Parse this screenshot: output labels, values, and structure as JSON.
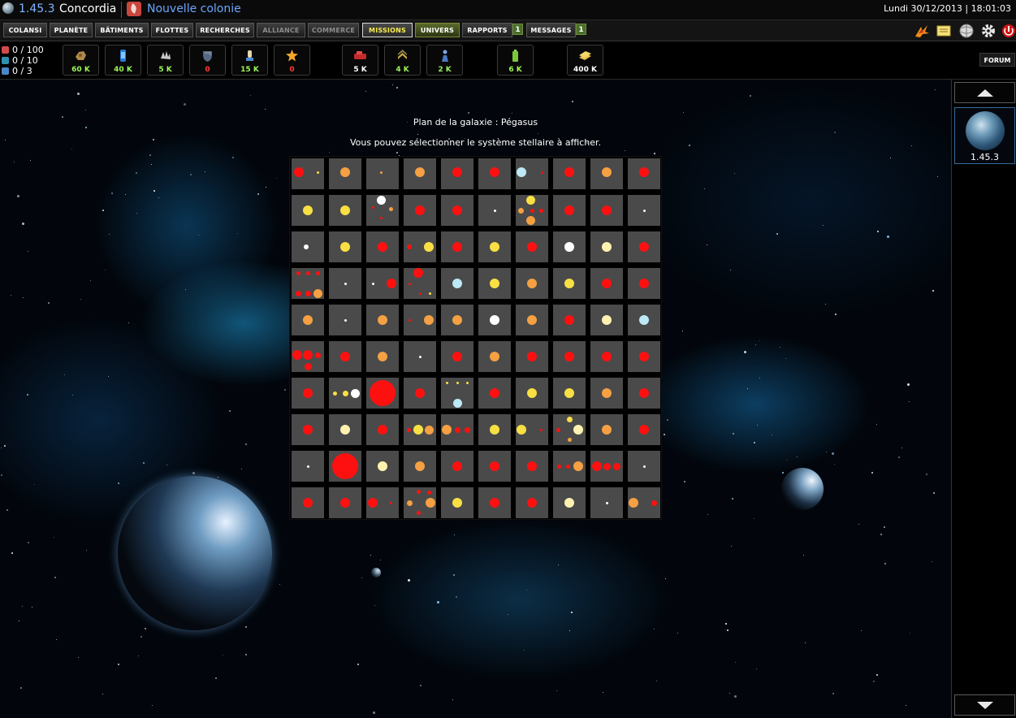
{
  "header": {
    "coords": "1.45.3",
    "planet_name": "Concordia",
    "new_colony": "Nouvelle colonie",
    "datetime": "Lundi 30/12/2013 | 18:01:03"
  },
  "nav": {
    "items": [
      {
        "label": "COLANSI"
      },
      {
        "label": "PLANÈTE"
      },
      {
        "label": "BÂTIMENTS"
      },
      {
        "label": "FLOTTES"
      },
      {
        "label": "RECHERCHES"
      },
      {
        "label": "ALLIANCE"
      },
      {
        "label": "COMMERCE"
      },
      {
        "label": "MISSIONS"
      },
      {
        "label": "UNIVERS"
      },
      {
        "label": "RAPPORTS",
        "badge": "1"
      },
      {
        "label": "MESSAGES",
        "badge": "1"
      }
    ],
    "top_icons": [
      "phoenix-icon",
      "notes-icon",
      "wiki-globe-icon",
      "gear-icon",
      "power-icon"
    ]
  },
  "stats": [
    {
      "text": "0 / 100",
      "icon": "population-icon"
    },
    {
      "text": "0 / 10",
      "icon": "fleet-slots-icon"
    },
    {
      "text": "0 / 3",
      "icon": "colony-slots-icon"
    }
  ],
  "resources": [
    {
      "icon": "ore-icon",
      "value": "60 K",
      "color": "#9bf55a"
    },
    {
      "icon": "fuel-cell-icon",
      "value": "40 K",
      "color": "#9bf55a"
    },
    {
      "icon": "crystal-icon",
      "value": "5 K",
      "color": "#9bf55a"
    },
    {
      "icon": "shield-resource-icon",
      "value": "0",
      "color": "#ff3b3b"
    },
    {
      "icon": "worker-icon",
      "value": "15 K",
      "color": "#9bf55a"
    },
    {
      "icon": "energy-star-icon",
      "value": "0",
      "color": "#ff3b3b"
    },
    {
      "icon": "tank-icon",
      "value": "5 K",
      "color": "#ffffff"
    },
    {
      "icon": "rank-insignia-icon",
      "value": "4 K",
      "color": "#9bf55a"
    },
    {
      "icon": "soldier-icon",
      "value": "2 K",
      "color": "#9bf55a"
    },
    {
      "icon": "battery-icon",
      "value": "6 K",
      "color": "#9bf55a"
    },
    {
      "icon": "credits-stack-icon",
      "value": "400 K",
      "color": "#ffffff"
    }
  ],
  "forum_label": "FORUM",
  "galaxy": {
    "title": "Plan de la galaxie : Pégasus",
    "subtitle": "Vous pouvez sélectionner le système stellaire à afficher.",
    "star_colors": {
      "r": "#ff1010",
      "o": "#f4a043",
      "y": "#f8df44",
      "w": "#ffffff",
      "pw": "#fff2b0",
      "b": "#bde8f6"
    },
    "cells": [
      [
        [
          "r",
          0.22,
          0.45,
          12
        ],
        [
          "y",
          0.82,
          0.45,
          3
        ]
      ],
      [
        [
          "o",
          0.5,
          0.45,
          12
        ]
      ],
      [
        [
          "o",
          0.45,
          0.45,
          3
        ]
      ],
      [
        [
          "o",
          0.5,
          0.45,
          12
        ]
      ],
      [
        [
          "r",
          0.5,
          0.45,
          12
        ]
      ],
      [
        [
          "r",
          0.5,
          0.45,
          12
        ]
      ],
      [
        [
          "b",
          0.18,
          0.45,
          12
        ],
        [
          "r",
          0.82,
          0.45,
          3
        ]
      ],
      [
        [
          "r",
          0.5,
          0.45,
          12
        ]
      ],
      [
        [
          "o",
          0.5,
          0.45,
          12
        ]
      ],
      [
        [
          "r",
          0.5,
          0.45,
          12
        ]
      ],
      [
        [
          "y",
          0.5,
          0.5,
          12
        ]
      ],
      [
        [
          "y",
          0.5,
          0.5,
          12
        ]
      ],
      [
        [
          "w",
          0.45,
          0.18,
          11
        ],
        [
          "o",
          0.75,
          0.45,
          5
        ],
        [
          "r",
          0.2,
          0.42,
          3
        ],
        [
          "r",
          0.45,
          0.75,
          3
        ]
      ],
      [
        [
          "r",
          0.5,
          0.5,
          12
        ]
      ],
      [
        [
          "r",
          0.5,
          0.5,
          12
        ]
      ],
      [
        [
          "w",
          0.5,
          0.5,
          3
        ]
      ],
      [
        [
          "y",
          0.45,
          0.18,
          11
        ],
        [
          "o",
          0.15,
          0.5,
          7
        ],
        [
          "r",
          0.5,
          0.5,
          5
        ],
        [
          "r",
          0.78,
          0.5,
          5
        ],
        [
          "o",
          0.45,
          0.82,
          11
        ]
      ],
      [
        [
          "r",
          0.5,
          0.5,
          12
        ]
      ],
      [
        [
          "r",
          0.5,
          0.5,
          12
        ]
      ],
      [
        [
          "w",
          0.5,
          0.5,
          3
        ]
      ],
      [
        [
          "w",
          0.45,
          0.5,
          6
        ]
      ],
      [
        [
          "y",
          0.5,
          0.5,
          12
        ]
      ],
      [
        [
          "r",
          0.5,
          0.5,
          12
        ]
      ],
      [
        [
          "r",
          0.18,
          0.5,
          6
        ],
        [
          "y",
          0.78,
          0.5,
          12
        ]
      ],
      [
        [
          "r",
          0.5,
          0.5,
          12
        ]
      ],
      [
        [
          "y",
          0.5,
          0.5,
          12
        ]
      ],
      [
        [
          "r",
          0.5,
          0.5,
          12
        ]
      ],
      [
        [
          "w",
          0.5,
          0.5,
          12
        ]
      ],
      [
        [
          "pw",
          0.5,
          0.5,
          12
        ]
      ],
      [
        [
          "r",
          0.5,
          0.5,
          12
        ]
      ],
      [
        [
          "r",
          0.2,
          0.18,
          5
        ],
        [
          "r",
          0.5,
          0.18,
          5
        ],
        [
          "r",
          0.82,
          0.18,
          5
        ],
        [
          "r",
          0.2,
          0.82,
          7
        ],
        [
          "r",
          0.5,
          0.82,
          7
        ],
        [
          "o",
          0.82,
          0.82,
          11
        ]
      ],
      [
        [
          "w",
          0.5,
          0.5,
          3
        ]
      ],
      [
        [
          "w",
          0.22,
          0.5,
          3
        ],
        [
          "r",
          0.78,
          0.5,
          12
        ]
      ],
      [
        [
          "r",
          0.45,
          0.15,
          12
        ],
        [
          "r",
          0.18,
          0.5,
          3
        ],
        [
          "r",
          0.5,
          0.82,
          3
        ],
        [
          "y",
          0.82,
          0.82,
          3
        ]
      ],
      [
        [
          "b",
          0.5,
          0.5,
          12
        ]
      ],
      [
        [
          "y",
          0.5,
          0.5,
          12
        ]
      ],
      [
        [
          "o",
          0.5,
          0.5,
          12
        ]
      ],
      [
        [
          "y",
          0.5,
          0.5,
          12
        ]
      ],
      [
        [
          "r",
          0.5,
          0.5,
          12
        ]
      ],
      [
        [
          "r",
          0.5,
          0.5,
          12
        ]
      ],
      [
        [
          "o",
          0.5,
          0.5,
          12
        ]
      ],
      [
        [
          "w",
          0.5,
          0.5,
          3
        ]
      ],
      [
        [
          "o",
          0.5,
          0.5,
          12
        ]
      ],
      [
        [
          "r",
          0.18,
          0.5,
          3
        ],
        [
          "o",
          0.78,
          0.5,
          12
        ]
      ],
      [
        [
          "o",
          0.5,
          0.5,
          12
        ]
      ],
      [
        [
          "w",
          0.5,
          0.5,
          12
        ]
      ],
      [
        [
          "o",
          0.5,
          0.5,
          12
        ]
      ],
      [
        [
          "r",
          0.5,
          0.5,
          12
        ]
      ],
      [
        [
          "pw",
          0.5,
          0.5,
          12
        ]
      ],
      [
        [
          "b",
          0.5,
          0.5,
          12
        ]
      ],
      [
        [
          "r",
          0.18,
          0.45,
          12
        ],
        [
          "r",
          0.5,
          0.45,
          12
        ],
        [
          "r",
          0.82,
          0.45,
          7
        ],
        [
          "r",
          0.5,
          0.82,
          9
        ]
      ],
      [
        [
          "r",
          0.5,
          0.5,
          12
        ]
      ],
      [
        [
          "o",
          0.5,
          0.5,
          12
        ]
      ],
      [
        [
          "w",
          0.5,
          0.5,
          3
        ]
      ],
      [
        [
          "r",
          0.5,
          0.5,
          12
        ]
      ],
      [
        [
          "o",
          0.5,
          0.5,
          12
        ]
      ],
      [
        [
          "r",
          0.5,
          0.5,
          12
        ]
      ],
      [
        [
          "r",
          0.5,
          0.5,
          12
        ]
      ],
      [
        [
          "r",
          0.5,
          0.5,
          12
        ]
      ],
      [
        [
          "r",
          0.5,
          0.5,
          12
        ]
      ],
      [
        [
          "r",
          0.5,
          0.5,
          12
        ]
      ],
      [
        [
          "y",
          0.18,
          0.5,
          5
        ],
        [
          "y",
          0.5,
          0.5,
          7
        ],
        [
          "w",
          0.8,
          0.5,
          11
        ]
      ],
      [
        [
          "r",
          0.5,
          0.5,
          32
        ]
      ],
      [
        [
          "r",
          0.5,
          0.5,
          12
        ]
      ],
      [
        [
          "b",
          0.5,
          0.82,
          11
        ],
        [
          "y",
          0.18,
          0.18,
          3
        ],
        [
          "y",
          0.5,
          0.18,
          3
        ],
        [
          "y",
          0.82,
          0.18,
          3
        ]
      ],
      [
        [
          "r",
          0.5,
          0.5,
          12
        ]
      ],
      [
        [
          "y",
          0.5,
          0.5,
          12
        ]
      ],
      [
        [
          "y",
          0.5,
          0.5,
          12
        ]
      ],
      [
        [
          "o",
          0.5,
          0.5,
          12
        ]
      ],
      [
        [
          "r",
          0.5,
          0.5,
          12
        ]
      ],
      [
        [
          "r",
          0.5,
          0.5,
          12
        ]
      ],
      [
        [
          "pw",
          0.5,
          0.5,
          12
        ]
      ],
      [
        [
          "r",
          0.5,
          0.5,
          12
        ]
      ],
      [
        [
          "r",
          0.15,
          0.5,
          5
        ],
        [
          "y",
          0.45,
          0.5,
          12
        ],
        [
          "o",
          0.78,
          0.5,
          11
        ]
      ],
      [
        [
          "o",
          0.18,
          0.5,
          12
        ],
        [
          "r",
          0.5,
          0.5,
          7
        ],
        [
          "r",
          0.82,
          0.5,
          7
        ]
      ],
      [
        [
          "y",
          0.5,
          0.5,
          12
        ]
      ],
      [
        [
          "y",
          0.18,
          0.5,
          12
        ],
        [
          "r",
          0.78,
          0.5,
          3
        ]
      ],
      [
        [
          "y",
          0.5,
          0.18,
          7
        ],
        [
          "r",
          0.15,
          0.5,
          5
        ],
        [
          "pw",
          0.78,
          0.5,
          12
        ],
        [
          "o",
          0.5,
          0.82,
          5
        ]
      ],
      [
        [
          "o",
          0.5,
          0.5,
          12
        ]
      ],
      [
        [
          "r",
          0.5,
          0.5,
          12
        ]
      ],
      [
        [
          "w",
          0.5,
          0.5,
          3
        ]
      ],
      [
        [
          "r",
          0.5,
          0.5,
          32
        ]
      ],
      [
        [
          "pw",
          0.5,
          0.5,
          12
        ]
      ],
      [
        [
          "o",
          0.5,
          0.5,
          12
        ]
      ],
      [
        [
          "r",
          0.5,
          0.5,
          12
        ]
      ],
      [
        [
          "r",
          0.5,
          0.5,
          12
        ]
      ],
      [
        [
          "r",
          0.5,
          0.5,
          12
        ]
      ],
      [
        [
          "r",
          0.18,
          0.5,
          5
        ],
        [
          "r",
          0.45,
          0.5,
          5
        ],
        [
          "o",
          0.78,
          0.5,
          12
        ]
      ],
      [
        [
          "r",
          0.2,
          0.5,
          12
        ],
        [
          "r",
          0.5,
          0.5,
          9
        ],
        [
          "r",
          0.82,
          0.5,
          9
        ]
      ],
      [
        [
          "w",
          0.5,
          0.5,
          3
        ]
      ],
      [
        [
          "r",
          0.5,
          0.5,
          12
        ]
      ],
      [
        [
          "r",
          0.5,
          0.5,
          12
        ]
      ],
      [
        [
          "r",
          0.2,
          0.5,
          12
        ],
        [
          "r",
          0.75,
          0.5,
          3
        ]
      ],
      [
        [
          "r",
          0.45,
          0.15,
          5
        ],
        [
          "r",
          0.78,
          0.18,
          5
        ],
        [
          "o",
          0.18,
          0.5,
          7
        ],
        [
          "o",
          0.82,
          0.5,
          12
        ],
        [
          "r",
          0.45,
          0.82,
          5
        ]
      ],
      [
        [
          "y",
          0.5,
          0.5,
          12
        ]
      ],
      [
        [
          "r",
          0.5,
          0.5,
          12
        ]
      ],
      [
        [
          "r",
          0.5,
          0.5,
          12
        ]
      ],
      [
        [
          "pw",
          0.5,
          0.5,
          12
        ]
      ],
      [
        [
          "w",
          0.5,
          0.5,
          3
        ]
      ],
      [
        [
          "o",
          0.18,
          0.5,
          12
        ],
        [
          "r",
          0.82,
          0.5,
          7
        ]
      ]
    ]
  },
  "sidebar": {
    "planet_coords": "1.45.3"
  }
}
